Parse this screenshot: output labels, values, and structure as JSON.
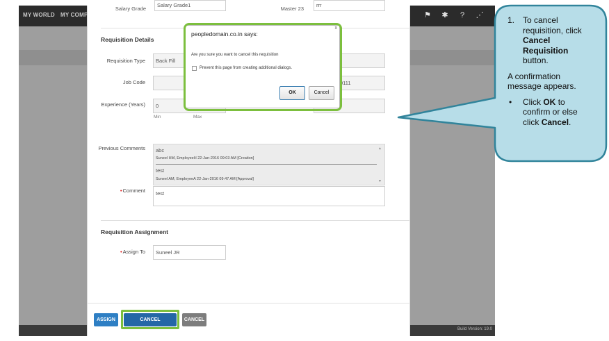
{
  "topbar": {
    "nav_items": [
      "MY WORLD",
      "MY COMPA"
    ],
    "icons": [
      "flag-icon",
      "tools-icon",
      "help-icon",
      "share-icon"
    ],
    "build_version": "Build Version: 19.0"
  },
  "form": {
    "cut_top": {
      "label1": "Salary Grade",
      "value1": "Salary Grade1",
      "label2": "Master 23",
      "value2": "rrr"
    },
    "requisition_details": {
      "title": "Requisition Details",
      "requisition_type_label": "Requisition Type",
      "requisition_type_value": "Back Fill",
      "job_code_label": "Job Code",
      "job_code_value": "",
      "job_code_right_value": "0111",
      "experience_label": "Experience (Years)",
      "experience_min_value": "0",
      "min_label": "Min",
      "max_label": "Max"
    },
    "previous_comments": {
      "label": "Previous Comments",
      "entries": [
        {
          "text": "abc",
          "meta": "Suneel HM,  EmployeeH  22-Jan-2016 09:03 AM [Creation]"
        },
        {
          "text": "test",
          "meta": "Suneel AM,  EmployeeA  22-Jan-2016 09:47 AM [Approval]"
        }
      ]
    },
    "comment": {
      "label": "Comment",
      "value": "test"
    },
    "assignment": {
      "title": "Requisition Assignment",
      "assign_to_label": "Assign To",
      "assign_to_value": "Suneel  JR"
    },
    "buttons": {
      "assign": "ASSIGN",
      "cancel_requisition": "CANCEL REQUISITION",
      "cancel": "CANCEL"
    }
  },
  "dialog": {
    "title": "peopledomain.co.in says:",
    "close": "x",
    "message": "Are you sure you want to cancel this requisition",
    "checkbox_label": "Prevent this page from creating additional dialogs.",
    "ok": "OK",
    "cancel": "Cancel"
  },
  "callout": {
    "step_number": "1.",
    "step_pre": "To cancel requisition, click",
    "step_bold": "Cancel Requisition",
    "step_post": "button.",
    "para": "A confirmation message appears.",
    "bullet_dot": "•",
    "bullet_pre": "Click",
    "bullet_ok": "OK",
    "bullet_mid": "to confirm or else click",
    "bullet_cancel": "Cancel",
    "bullet_end": ".",
    "fill_color": "#b7dde8",
    "border_color": "#31849b"
  },
  "colors": {
    "highlight": "#7cbf3e",
    "assign_button": "#2e7fc4",
    "cancel_requisition_button": "#2467a6",
    "cancel_button": "#7d7d7d",
    "topbar": "#2b2b2b"
  }
}
